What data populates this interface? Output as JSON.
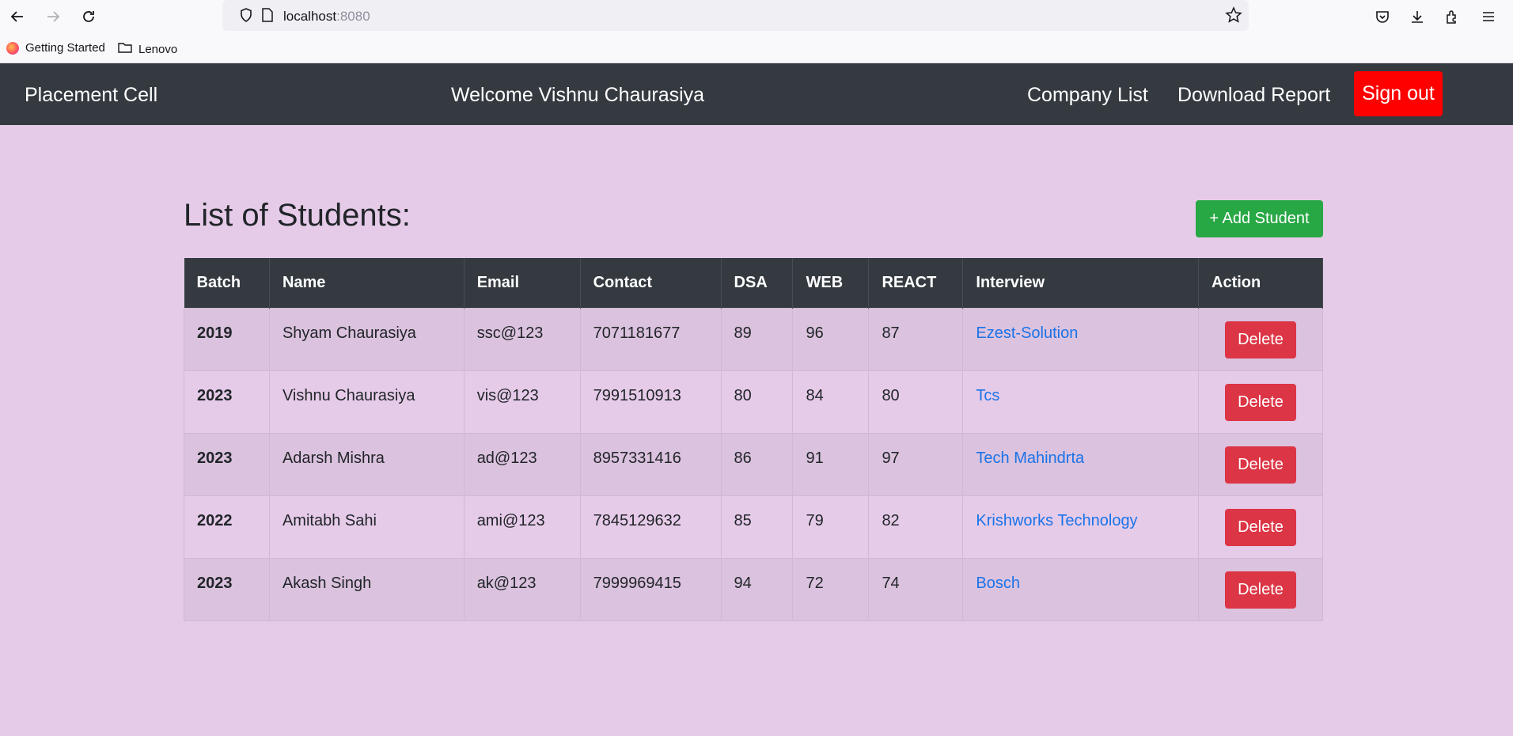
{
  "browser": {
    "url_host": "localhost",
    "url_port": ":8080",
    "bookmarks": [
      "Getting Started",
      "Lenovo"
    ]
  },
  "nav": {
    "brand": "Placement Cell",
    "welcome": "Welcome Vishnu Chaurasiya",
    "links": [
      "Company List",
      "Download Report"
    ],
    "signout": "Sign out"
  },
  "page": {
    "heading": "List of Students:",
    "add_button": "+ Add Student"
  },
  "table": {
    "headers": [
      "Batch",
      "Name",
      "Email",
      "Contact",
      "DSA",
      "WEB",
      "REACT",
      "Interview",
      "Action"
    ],
    "rows": [
      {
        "batch": "2019",
        "name": "Shyam Chaurasiya",
        "email": "ssc@123",
        "contact": "7071181677",
        "dsa": "89",
        "web": "96",
        "react": "87",
        "interview": "Ezest-Solution",
        "action": "Delete"
      },
      {
        "batch": "2023",
        "name": "Vishnu Chaurasiya",
        "email": "vis@123",
        "contact": "7991510913",
        "dsa": "80",
        "web": "84",
        "react": "80",
        "interview": "Tcs",
        "action": "Delete"
      },
      {
        "batch": "2023",
        "name": "Adarsh Mishra",
        "email": "ad@123",
        "contact": "8957331416",
        "dsa": "86",
        "web": "91",
        "react": "97",
        "interview": "Tech Mahindrta",
        "action": "Delete"
      },
      {
        "batch": "2022",
        "name": "Amitabh Sahi",
        "email": "ami@123",
        "contact": "7845129632",
        "dsa": "85",
        "web": "79",
        "react": "82",
        "interview": "Krishworks Technology",
        "action": "Delete"
      },
      {
        "batch": "2023",
        "name": "Akash Singh",
        "email": "ak@123",
        "contact": "7999969415",
        "dsa": "94",
        "web": "72",
        "react": "74",
        "interview": "Bosch",
        "action": "Delete"
      }
    ]
  },
  "colors": {
    "page_bg": "#e6cbe9",
    "nav_bg": "#343a40",
    "signout": "#ff0000",
    "add": "#28a745",
    "delete": "#dc3545",
    "link": "#1a73e8"
  }
}
